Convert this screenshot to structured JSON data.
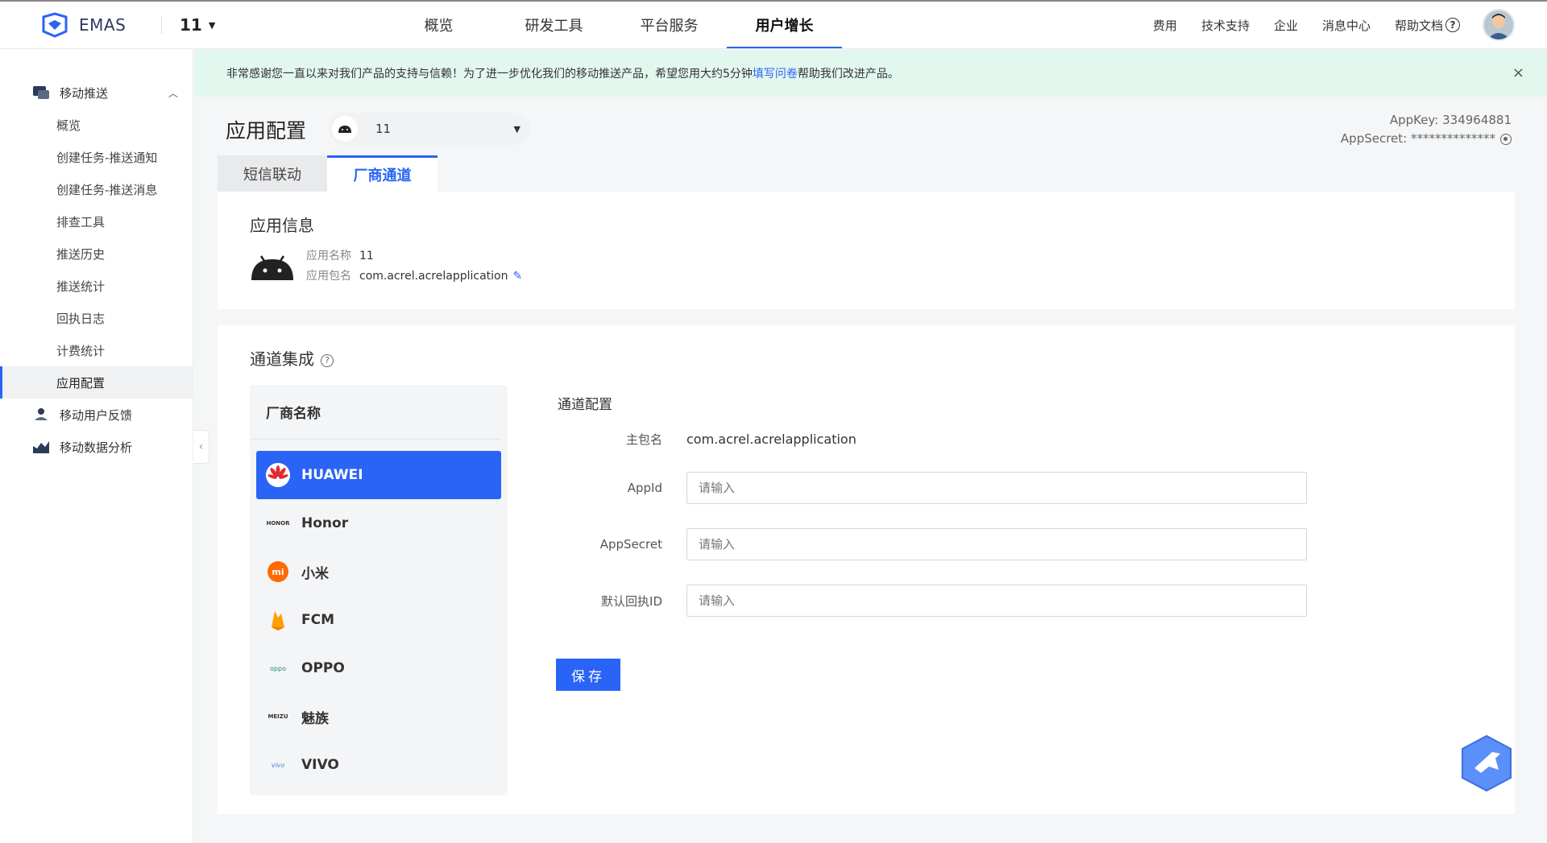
{
  "topbar": {
    "logo_text": "EMAS",
    "app_selector": "11",
    "nav": [
      "概览",
      "研发工具",
      "平台服务",
      "用户增长"
    ],
    "active_nav": "用户增长",
    "right_links": [
      "费用",
      "技术支持",
      "企业",
      "消息中心",
      "帮助文档"
    ]
  },
  "sidebar": {
    "group1": "移动推送",
    "items": [
      "概览",
      "创建任务-推送通知",
      "创建任务-推送消息",
      "排查工具",
      "推送历史",
      "推送统计",
      "回执日志",
      "计费统计",
      "应用配置"
    ],
    "active_item": "应用配置",
    "group2": "移动用户反馈",
    "group3": "移动数据分析"
  },
  "notice": {
    "text_before": "非常感谢您一直以来对我们产品的支持与信赖！为了进一步优化我们的移动推送产品，希望您用大约5分钟",
    "link": "填写问卷",
    "text_after": "帮助我们改进产品。",
    "close": "×"
  },
  "header": {
    "title": "应用配置",
    "app_value": "11",
    "appkey": "AppKey: 334964881",
    "appsecret": "AppSecret: **************"
  },
  "tabs": [
    "短信联动",
    "厂商通道"
  ],
  "app_info": {
    "title": "应用信息",
    "name_label": "应用名称",
    "name_value": "11",
    "package_label": "应用包名",
    "package_value": "com.acrel.acrelapplication"
  },
  "channel": {
    "title": "通道集成",
    "vendor_header": "厂商名称",
    "vendors": [
      "HUAWEI",
      "Honor",
      "小米",
      "FCM",
      "OPPO",
      "魅族",
      "VIVO"
    ],
    "active_vendor": "HUAWEI",
    "config_title": "通道配置",
    "fields": {
      "main_package_label": "主包名",
      "main_package_value": "com.acrel.acrelapplication",
      "appid_label": "AppId",
      "appsecret_label": "AppSecret",
      "receipt_label": "默认回执ID",
      "placeholder": "请输入"
    },
    "save_label": "保存"
  },
  "colors": {
    "primary": "#2a64f6",
    "notice_bg": "#e2f7ee",
    "huawei_red": "#e3292e",
    "xiaomi_orange": "#ff6900"
  }
}
